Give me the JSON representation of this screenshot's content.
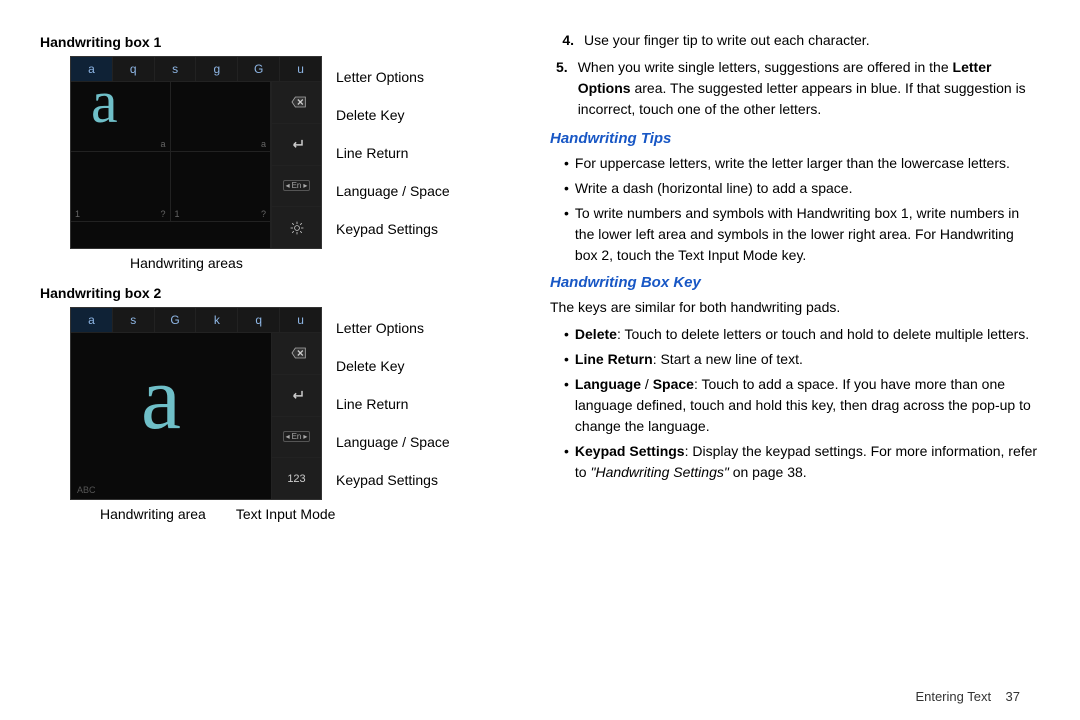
{
  "left": {
    "box1_label": "Handwriting box 1",
    "box2_label": "Handwriting box 2",
    "letters1": [
      "a",
      "q",
      "s",
      "g",
      "G",
      "u"
    ],
    "letters2": [
      "a",
      "s",
      "G",
      "k",
      "q",
      "u"
    ],
    "small_a": "a",
    "small_1": "1",
    "small_q": "?",
    "abc": "ABC",
    "en": "En",
    "num123": "123",
    "callouts1": {
      "letter_options": "Letter Options",
      "delete": "Delete Key",
      "line_return": "Line Return",
      "lang_space": "Language / Space",
      "keypad": "Keypad Settings"
    },
    "callouts2": {
      "letter_options": "Letter Options",
      "delete": "Delete Key",
      "line_return": "Line Return",
      "lang_space": "Language / Space",
      "keypad": "Keypad Settings"
    },
    "below1": {
      "areas": "Handwriting areas"
    },
    "below2": {
      "area": "Handwriting area",
      "mode": "Text Input Mode"
    }
  },
  "right": {
    "step4_n": "4.",
    "step4": "Use your finger tip to write out each character.",
    "step5_n": "5.",
    "step5_a": "When you write single letters, suggestions are offered in the ",
    "step5_b": "Letter Options",
    "step5_c": " area. The suggested letter appears in blue. If that suggestion is incorrect, touch one of the other letters.",
    "tips_head": "Handwriting Tips",
    "tip1": "For uppercase letters, write the letter larger than the lowercase letters.",
    "tip2": "Write a dash (horizontal line) to add a space.",
    "tip3": "To write numbers and symbols with Handwriting box 1, write numbers in the lower left area and symbols in the lower right area. For Handwriting box 2, touch the Text Input Mode key.",
    "key_head": "Handwriting Box Key",
    "key_intro": "The keys are similar for both handwriting pads.",
    "k_delete_b": "Delete",
    "k_delete": ": Touch to delete letters or touch and hold to delete multiple letters.",
    "k_line_b": "Line Return",
    "k_line": ": Start a new line of text.",
    "k_lang_b": "Language",
    "k_lang_sep": " / ",
    "k_lang_b2": "Space",
    "k_lang": ": Touch to add a space. If you have more than one language defined, touch and hold this key, then drag across the pop-up to change the language.",
    "k_set_b": "Keypad Settings",
    "k_set_a": ": Display the keypad settings. For more information, refer to ",
    "k_set_i": "\"Handwriting Settings\"",
    "k_set_c": "  on page 38."
  },
  "footer": {
    "section": "Entering Text",
    "page": "37"
  }
}
